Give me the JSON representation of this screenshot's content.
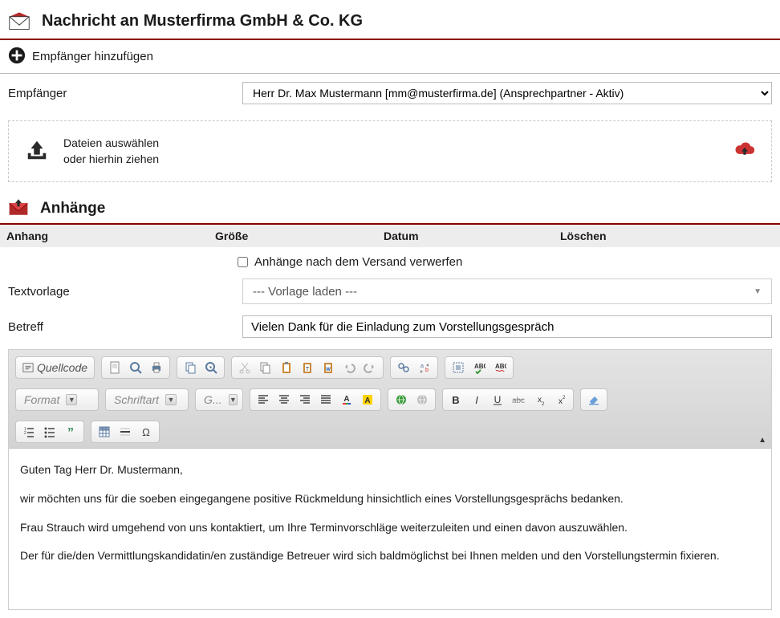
{
  "header": {
    "title": "Nachricht an Musterfirma GmbH & Co. KG"
  },
  "addRecipient": {
    "label": "Empfänger hinzufügen"
  },
  "recipient": {
    "label": "Empfänger",
    "selected": "Herr Dr. Max Mustermann [mm@musterfirma.de] (Ansprechpartner - Aktiv)"
  },
  "upload": {
    "line1": "Dateien auswählen",
    "line2": "oder hierhin ziehen"
  },
  "attachments": {
    "heading": "Anhänge",
    "cols": {
      "anhang": "Anhang",
      "groesse": "Größe",
      "datum": "Datum",
      "loeschen": "Löschen"
    },
    "discard": "Anhänge nach dem Versand verwerfen"
  },
  "template": {
    "label": "Textvorlage",
    "placeholder": "--- Vorlage laden ---"
  },
  "subject": {
    "label": "Betreff",
    "value": "Vielen Dank für die Einladung zum Vorstellungsgespräch"
  },
  "toolbar": {
    "quellcode": "Quellcode",
    "format": "Format",
    "font": "Schriftart",
    "size": "G..."
  },
  "body": {
    "p1": "Guten Tag Herr Dr. Mustermann,",
    "p2": "wir möchten uns für die soeben eingegangene positive Rückmeldung  hinsichtlich eines Vorstellungsgesprächs bedanken.",
    "p3": "Frau Strauch wird umgehend von uns kontaktiert, um Ihre Terminvorschläge weiterzuleiten und einen davon auszuwählen.",
    "p4": "Der für die/den Vermittlungskandidatin/en zuständige Betreuer wird sich baldmöglichst bei Ihnen melden und den Vorstellungstermin fixieren."
  }
}
